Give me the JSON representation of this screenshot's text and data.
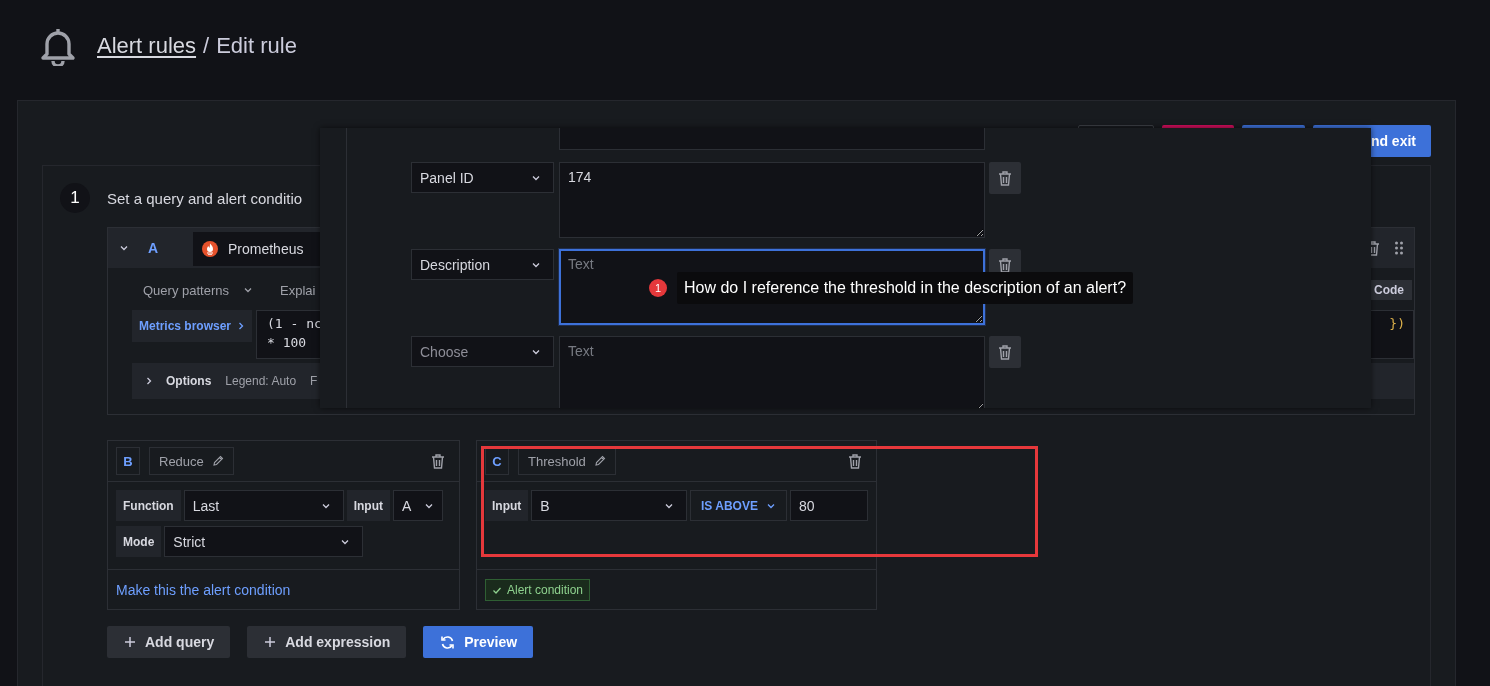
{
  "header": {
    "breadcrumb_link": "Alert rules",
    "separator": "/",
    "current": "Edit rule"
  },
  "toolbar_buttons": [
    {
      "kind": "secondary"
    },
    {
      "kind": "destructive"
    },
    {
      "kind": "primary"
    },
    {
      "kind": "primary",
      "label": "nd exit"
    }
  ],
  "step": {
    "number": "1",
    "title": "Set a query and alert conditio"
  },
  "query": {
    "ref": "A",
    "expanded": true,
    "datasource": "Prometheus",
    "query_patterns": "Query patterns",
    "explain": "Explai",
    "code_button": "Code",
    "metrics_browser": "Metrics browser",
    "editor_lines": [
      "(1 - nc",
      "* 100"
    ],
    "editor_tail": "})",
    "options": {
      "label": "Options",
      "legend": "Legend: Auto",
      "more": "F"
    }
  },
  "expressions": [
    {
      "ref": "B",
      "name": "Reduce",
      "rows": [
        [
          {
            "kind": "label",
            "text": "Function"
          },
          {
            "kind": "select",
            "text": "Last"
          },
          {
            "kind": "label",
            "text": "Input"
          },
          {
            "kind": "select",
            "text": "A"
          }
        ],
        [
          {
            "kind": "label",
            "text": "Mode"
          },
          {
            "kind": "select",
            "text": "Strict"
          }
        ]
      ],
      "alert_condition": false,
      "condition_label": "Make this the alert condition"
    },
    {
      "ref": "C",
      "name": "Threshold",
      "rows": [
        [
          {
            "kind": "label",
            "text": "Input"
          },
          {
            "kind": "select",
            "text": "B"
          },
          {
            "kind": "operator",
            "text": "IS ABOVE"
          },
          {
            "kind": "input",
            "text": "80"
          }
        ]
      ],
      "alert_condition": true,
      "condition_label": "Alert condition"
    }
  ],
  "footer_buttons": [
    {
      "kind": "add",
      "label": "Add query"
    },
    {
      "kind": "add",
      "label": "Add expression"
    },
    {
      "kind": "preview",
      "label": "Preview"
    }
  ],
  "popup": {
    "rows": [
      {
        "key": "Panel ID",
        "key_placeholder": false,
        "value": "174",
        "focused": false
      },
      {
        "key": "Description",
        "key_placeholder": false,
        "placeholder": "Text",
        "focused": true
      },
      {
        "key": "Choose",
        "key_placeholder": true,
        "placeholder": "Text",
        "focused": false
      }
    ]
  },
  "annotation": {
    "number": "1",
    "text": "How do I reference the threshold in the description of an alert?"
  }
}
